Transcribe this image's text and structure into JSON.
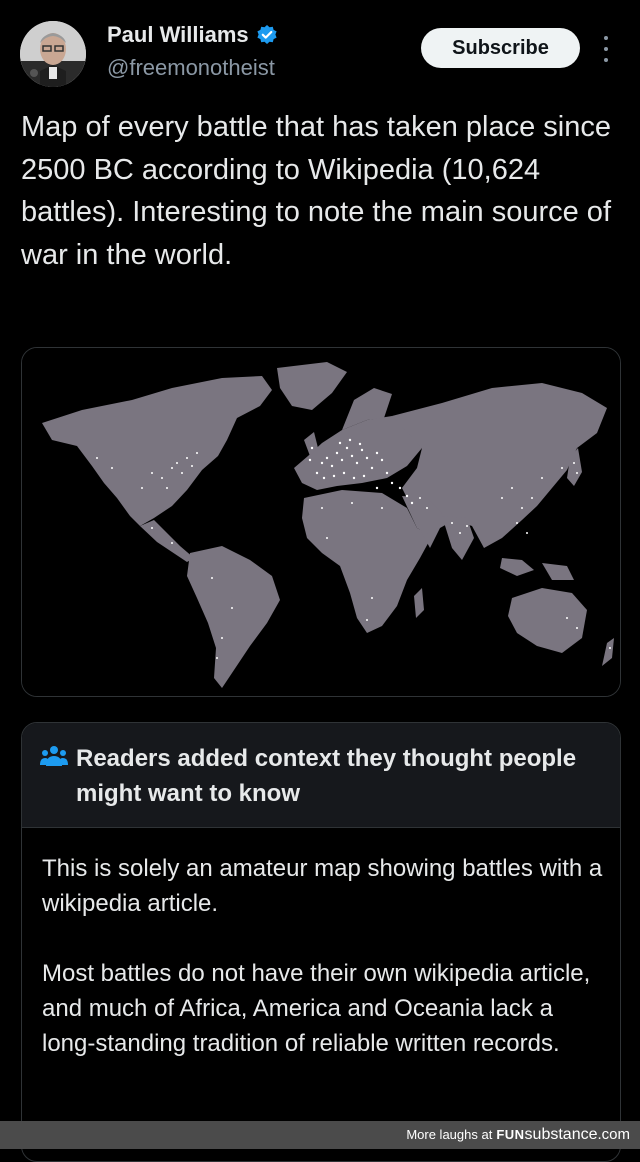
{
  "author": {
    "name": "Paul Williams",
    "handle": "@freemonotheist",
    "verified_icon": "verified-badge-icon",
    "verified_color": "#1d9bf0"
  },
  "actions": {
    "subscribe_label": "Subscribe",
    "more_icon": "more-options-icon"
  },
  "tweet": {
    "text": "Map of every battle that has taken place since 2500 BC according to Wikipedia (10,624 battles). Interesting to note the main source of war in the world."
  },
  "media": {
    "description_icon": "world-battle-map-image",
    "land_color": "#7a7580",
    "dot_color": "#ffffff",
    "background_color": "#000000"
  },
  "community_note": {
    "icon": "people-icon",
    "icon_color": "#1d9bf0",
    "title": "Readers added context they thought people might want to know",
    "paragraphs": [
      "This is solely an amateur map showing battles with a wikipedia article.",
      "Most battles do not have their own wikipedia article, and much of Africa, America and Oceania lack a long-standing tradition of reliable written records."
    ]
  },
  "footer": {
    "text": "More laughs at",
    "brand_part1": "FUN",
    "brand_part2": "substance",
    "brand_part3": ".com"
  }
}
